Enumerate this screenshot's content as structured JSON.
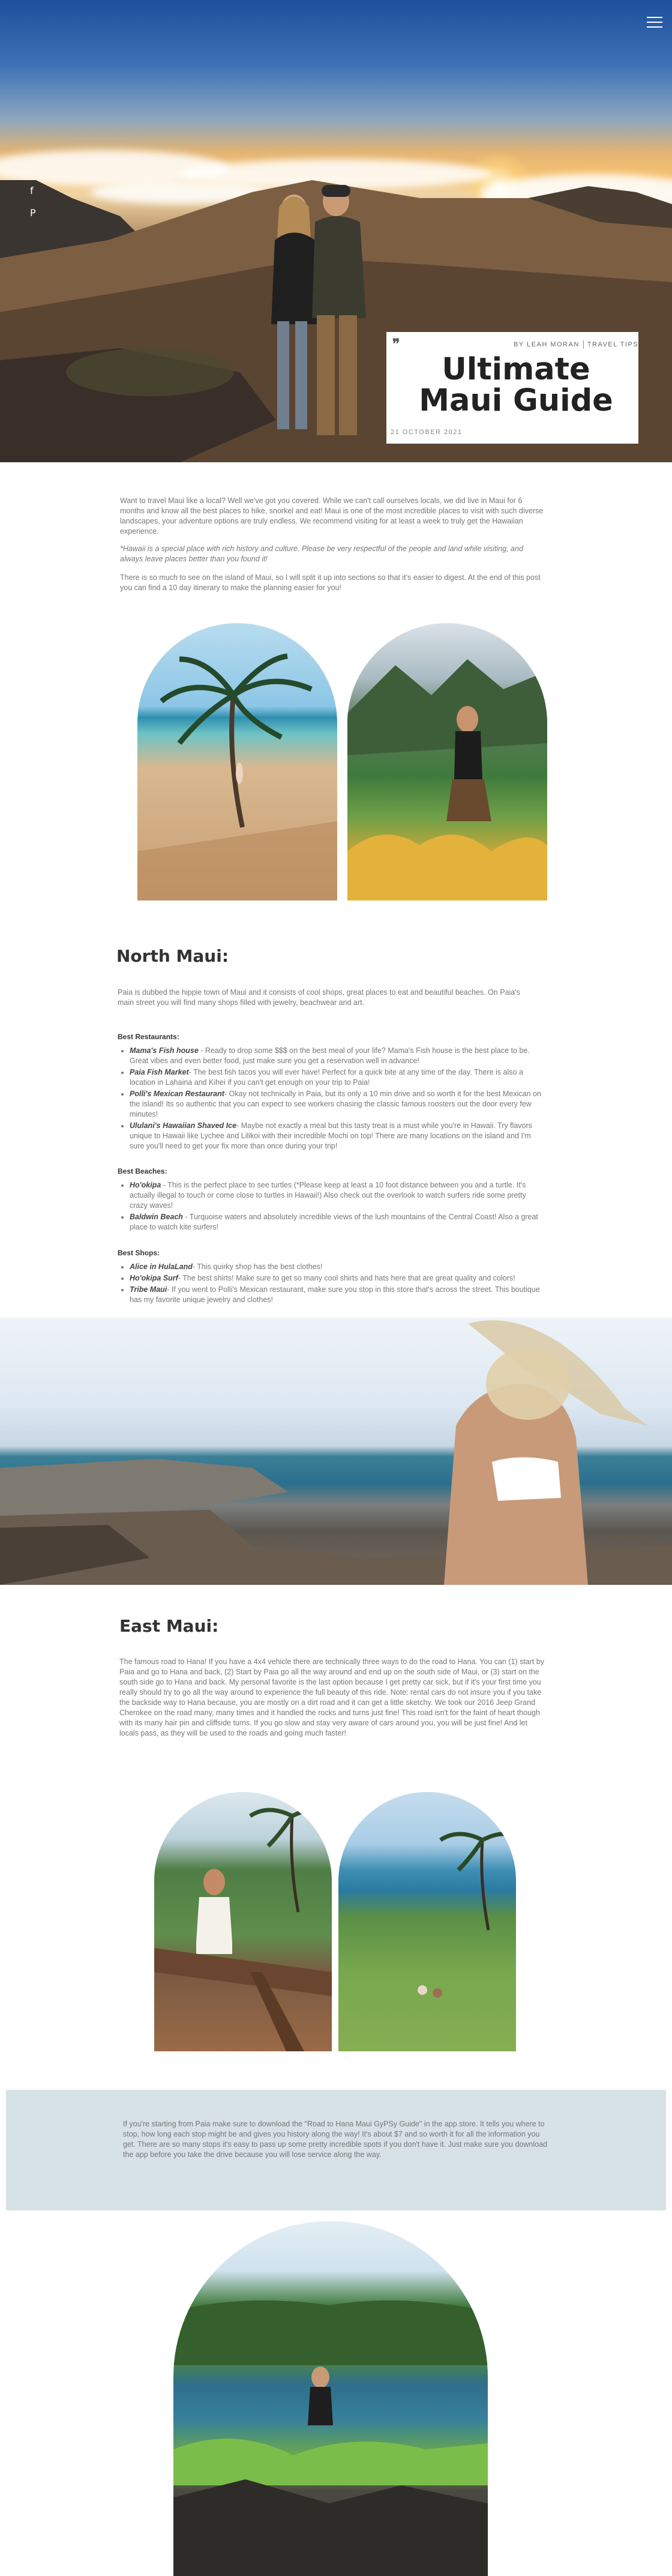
{
  "header": {
    "menu_icon": "hamburger-menu-icon",
    "social": [
      {
        "icon": "facebook-icon",
        "glyph": "f"
      },
      {
        "icon": "pinterest-icon",
        "glyph": "P"
      }
    ]
  },
  "post": {
    "author": "BY LEAH MORAN",
    "category": "TRAVEL TIPS",
    "title": "Ultimate Maui Guide",
    "date": "21 OCTOBER 2021"
  },
  "intro": {
    "p1": "Want to travel Maui like a local? Well we've got you covered. While we can't call ourselves locals, we did live in Maui for 6 months and know all the best places to hike, snorkel and eat! Maui is one of the most incredible places to visit with such diverse landscapes, your adventure options are truly endless. We recommend visiting for at least a week to truly get the Hawaiian experience.",
    "p2": "*Hawaii is a special place with rich history and culture. Please be very respectful of the people and land while visiting, and always leave places better than you found it!",
    "p3": "There is so much to see on the island of Maui, so I will split it up into sections so that it's easier to digest. At the end of this post you can find a 10 day itinerary to make the planning easier for you!"
  },
  "north": {
    "heading": "North Maui:",
    "intro": "Paia is dubbed the hippie town of Maui and it consists of cool shops, great places to eat and beautiful beaches. On Paia's main street you will find many shops filled with jewelry, beachwear and art.",
    "restaurants_label": "Best Restaurants:",
    "restaurants": [
      {
        "name": "Mama's Fish house",
        "text": " - Ready to drop some $$$ on the best meal of your life? Mama's Fish house is the best place to be. Great vibes and even better food, just make sure you get a reservation well in advance!"
      },
      {
        "name": "Paia Fish Market",
        "text": "- The best fish tacos you will ever have! Perfect for a quick bite at any time of the day. There is also a location in Lahaina and Kihei if you can't get enough on your trip to Paia!"
      },
      {
        "name": "Polli's Mexican Restaurant",
        "text": "- Okay not technically in Paia, but its only a 10 min drive and so worth it for the best Mexican on the island! Its so authentic that you can expect to see workers chasing the classic famous roosters out the door every few minutes!"
      },
      {
        "name": "Ululani's Hawaiian Shaved Ice",
        "text": "- Maybe not exactly a meal but this tasty treat is a must while you're in Hawaii. Try flavors unique to Hawaii like Lychee and Lilikoi with their incredible Mochi on top! There are many locations on the island and I'm sure you'll need to get your fix more than once during your trip!"
      }
    ],
    "beaches_label": "Best Beaches:",
    "beaches": [
      {
        "name": "Ho'okipa",
        "text": " - This is the perfect place to see turtles (*Please keep at least a 10 foot distance between you and a turtle. It's actually illegal to touch or come close to turtles in Hawaii!) Also check out the overlook to watch surfers ride some pretty crazy waves!"
      },
      {
        "name": "Baldwin Beach",
        "text": " - Turquoise waters and absolutely incredible views of the lush mountains of the Central Coast! Also a great place to watch kite surfers!"
      }
    ],
    "shops_label": "Best Shops:",
    "shops": [
      {
        "name": "Alice in HulaLand",
        "text": "- This quirky shop has the best clothes!"
      },
      {
        "name": "Ho'okipa Surf",
        "text": "- The best shirts! Make sure to get so many cool shirts and hats here that are great quality and colors!"
      },
      {
        "name": "Tribe Maui",
        "text": "- If you went to Polli's Mexican restaurant, make sure you stop in this store that's across the street. This boutique has my favorite unique jewelry and clothes!"
      }
    ]
  },
  "east": {
    "heading": "East Maui:",
    "p1": "The famous road to Hana! If you have a 4x4 vehicle there are technically three ways to do the road to Hana. You can (1) start by Paia and go to Hana and back, (2) Start by Paia go all the way around and end up on the south side of Maui, or (3) start on the south side go to Hana and back. My personal favorite is the last option because I get pretty car sick, but if it's your first time you really should try to go all the way around to experience the full beauty of this ride. Note: rental cars do not insure you if you take the backside way to Hana because, you are mostly on a dirt road and it can get a little sketchy. We took our 2016 Jeep Grand Cherokee on the road many, many times and it handled the rocks and turns just fine! This road isn't for the faint of heart though with its many hair pin and cliffside turns. If you go slow and stay very aware of cars around you, you will be just fine! And let locals pass, as they will be used to the roads and going much faster!",
    "callout": "If you're starting from Paia make sure to download the \"Road to Hana Maui GyPSy Guide\" in the app store. It tells you where to stop, how long each stop might be and gives you history along the way! It's about $7 and so worth it for all the information you get. There are so many stops it's easy to pass up some pretty incredible spots if you don't have it. Just make sure you download the app before you take the drive because you will lose service along the way."
  },
  "colors": {
    "callout_bg": "#d7e2e6",
    "title": "#222222",
    "body_text": "#777777"
  }
}
